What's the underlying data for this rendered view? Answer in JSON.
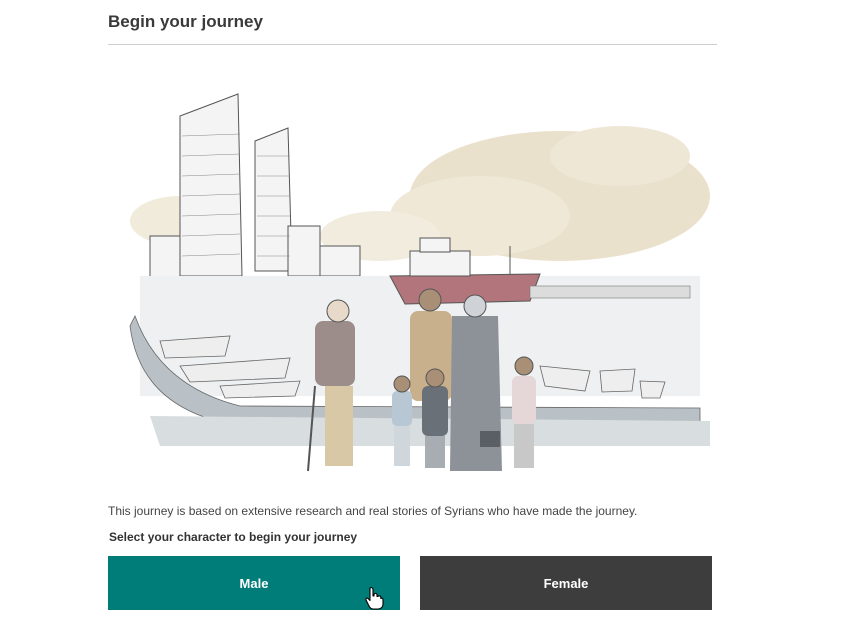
{
  "page": {
    "title": "Begin your journey"
  },
  "intro": {
    "text": "This journey is based on extensive research and real stories of Syrians who have made the journey."
  },
  "selection": {
    "prompt": "Select your character to begin your journey",
    "male_label": "Male",
    "female_label": "Female"
  },
  "colors": {
    "male_button": "#007d78",
    "female_button": "#3d3d3d",
    "title_text": "#3a3a3a"
  },
  "icons": {
    "cursor": "hand-pointer-icon"
  }
}
